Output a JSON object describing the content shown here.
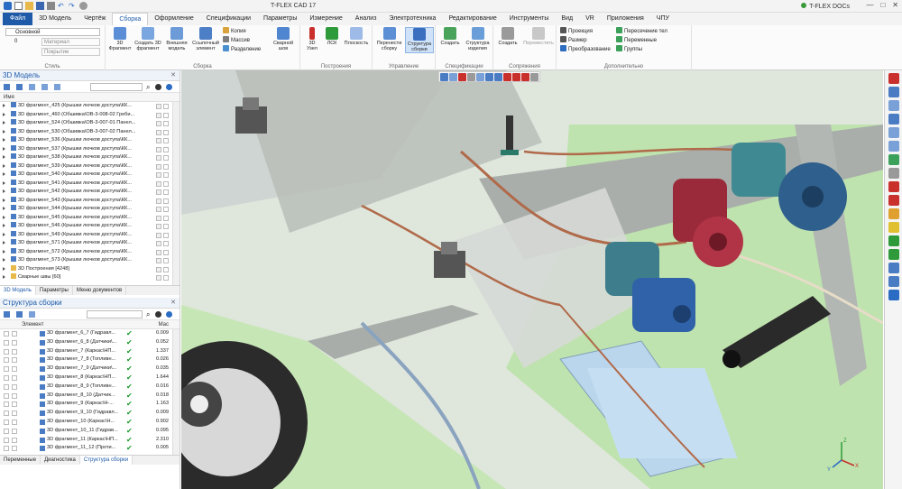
{
  "app": {
    "title": "T-FLEX CAD 17",
    "docs_label": "T-FLEX DOCs",
    "win_min": "—",
    "win_max": "□",
    "win_close": "✕"
  },
  "menu": [
    "Файл",
    "3D Модель",
    "Чертёж",
    "Сборка",
    "Оформление",
    "Спецификации",
    "Параметры",
    "Измерение",
    "Анализ",
    "Электротехника",
    "Редактирование",
    "Инструменты",
    "Вид",
    "VR",
    "Приложения",
    "ЧПУ"
  ],
  "menu_active": "Сборка",
  "ribbon": {
    "style": {
      "group": "Стиль",
      "style_value": "Основной",
      "layer_value": "0",
      "material_placeholder": "Материал",
      "cover_placeholder": "Покрытие"
    },
    "assembly": {
      "group": "Сборка",
      "frag3d": "3D Фрагмент",
      "create3d": "Создать 3D фрагмент",
      "external": "Внешняя модель",
      "reference": "Ссылочный элемент",
      "copy": "Копия",
      "array": "Массив",
      "split": "Разделение",
      "weld": "Сварной шов"
    },
    "construction": {
      "group": "Построения",
      "node3d": "3D Узел",
      "lcs": "ЛСК",
      "plane": "Плоскость"
    },
    "management": {
      "group": "Управление",
      "rearrange": "Перенести сборку",
      "structure": "Структура сборки"
    },
    "spec": {
      "group": "Спецификации",
      "create": "Создать",
      "product": "Структура изделия"
    },
    "mates": {
      "group": "Сопряжения",
      "create": "Создать",
      "move": "Переместить"
    },
    "extra": {
      "group": "Дополнительно",
      "projection": "Проекция",
      "size": "Размер",
      "transform": "Преобразование",
      "intersect": "Пересечение тел",
      "variables": "Переменные",
      "groups": "Группы"
    }
  },
  "model_panel": {
    "title": "3D Модель",
    "col_name": "Имя",
    "rows": [
      "3D фрагмент_425 (Крышки лючков доступа\\КК...",
      "3D фрагмент_460 (Обшивка\\ОВ-3-008-02 Греби...",
      "3D фрагмент_524 (Обшивка\\ОВ-3-007-01 Панел...",
      "3D фрагмент_530 (Обшивка\\ОВ-3-007-02 Панел...",
      "3D фрагмент_536 (Крышки лючков доступа\\КК...",
      "3D фрагмент_537 (Крышки лючков доступа\\КК...",
      "3D фрагмент_538 (Крышки лючков доступа\\КК...",
      "3D фрагмент_539 (Крышки лючков доступа\\КК...",
      "3D фрагмент_540 (Крышки лючков доступа\\КК...",
      "3D фрагмент_541 (Крышки лючков доступа\\КК...",
      "3D фрагмент_542 (Крышки лючков доступа\\КК...",
      "3D фрагмент_543 (Крышки лючков доступа\\КК...",
      "3D фрагмент_544 (Крышки лючков доступа\\КК...",
      "3D фрагмент_545 (Крышки лючков доступа\\КК...",
      "3D фрагмент_546 (Крышки лючков доступа\\КК...",
      "3D фрагмент_549 (Крышки лючков доступа\\КК...",
      "3D фрагмент_571 (Крышки лючков доступа\\КК...",
      "3D фрагмент_572 (Крышки лючков доступа\\КК...",
      "3D фрагмент_573 (Крышки лючков доступа\\КК...",
      "3D Построения [4248]",
      "Сварные швы [60]"
    ],
    "tabs": [
      "3D Модель",
      "Параметры",
      "Меню документов"
    ]
  },
  "assembly_panel": {
    "title": "Структура сборки",
    "col_element": "Элемент",
    "col_mass": "Мас",
    "rows": [
      {
        "name": "3D фрагмент_6_7 (Гидравл...",
        "mass": "0.009"
      },
      {
        "name": "3D фрагмент_6_8 (Датчики\\...",
        "mass": "0.052"
      },
      {
        "name": "3D фрагмент_7 (Каркас\\НП...",
        "mass": "1.337"
      },
      {
        "name": "3D фрагмент_7_8 (Топливн...",
        "mass": "0.026"
      },
      {
        "name": "3D фрагмент_7_9 (Датчики\\...",
        "mass": "0.035"
      },
      {
        "name": "3D фрагмент_8 (Каркас\\НП...",
        "mass": "1.644"
      },
      {
        "name": "3D фрагмент_8_9 (Топливн...",
        "mass": "0.016"
      },
      {
        "name": "3D фрагмент_8_10 (Датчик...",
        "mass": "0.018"
      },
      {
        "name": "3D фрагмент_9 (Каркас\\Н-...",
        "mass": "1.163"
      },
      {
        "name": "3D фрагмент_9_10 (Гидравл...",
        "mass": "0.009"
      },
      {
        "name": "3D фрагмент_10 (Каркас\\Н...",
        "mass": "0.902"
      },
      {
        "name": "3D фрагмент_10_11 (Гидрав...",
        "mass": "0.095"
      },
      {
        "name": "3D фрагмент_11 (Каркас\\НП...",
        "mass": "2.310"
      },
      {
        "name": "3D фрагмент_11_12 (Проти...",
        "mass": "0.005"
      }
    ],
    "tabs": [
      "Переменные",
      "Диагностика",
      "Структура сборки"
    ]
  },
  "viewport": {
    "axis_x": "X",
    "axis_y": "Y",
    "axis_z": "Z"
  }
}
